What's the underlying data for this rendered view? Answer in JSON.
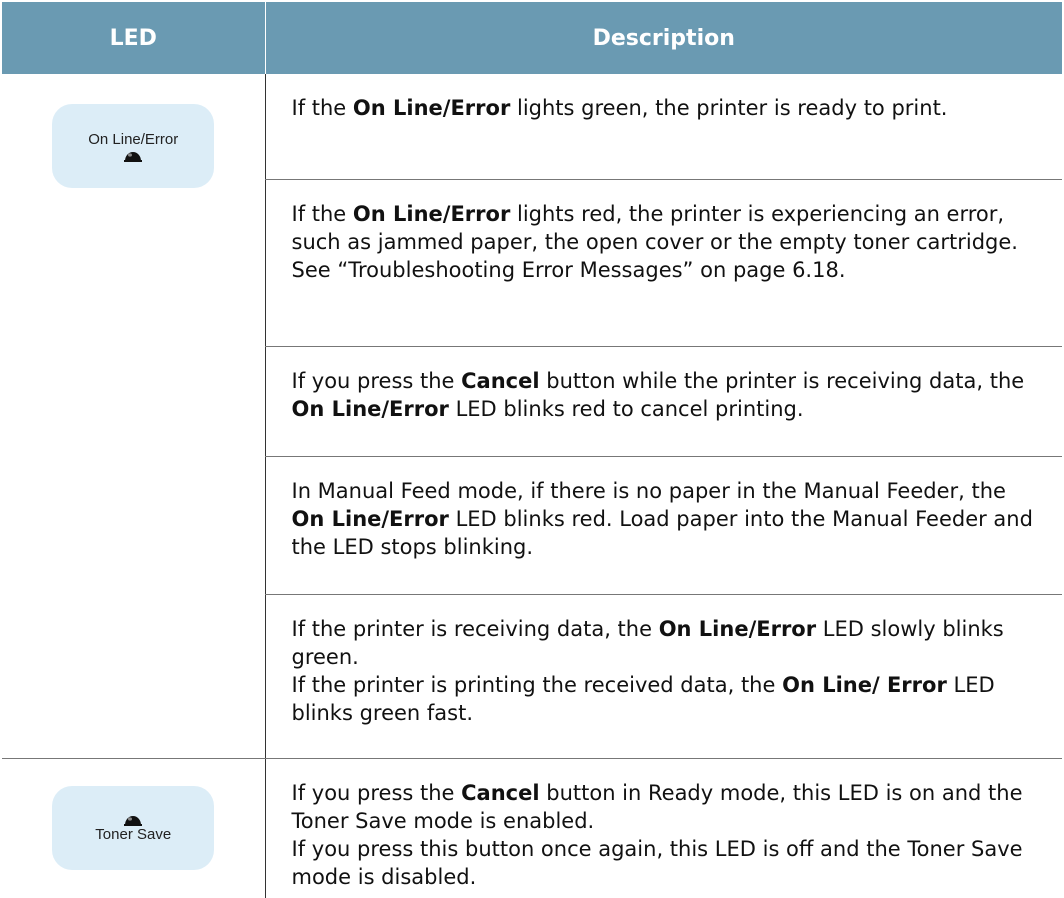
{
  "table": {
    "headers": {
      "led": "LED",
      "description": "Description"
    },
    "leds": {
      "online_error": {
        "label": "On Line/Error",
        "icon": "led-dot-icon"
      },
      "toner_save": {
        "label": "Toner Save",
        "icon": "led-dot-icon"
      }
    },
    "rows": [
      {
        "p1": "If the ",
        "b1": "On Line/Error",
        "p2": " lights green, the printer is ready to print."
      },
      {
        "p1": "If the ",
        "b1": "On Line/Error",
        "p2": " lights red, the printer is experiencing an error, such as jammed paper, the open cover or the empty toner cartridge. See “Troubleshooting Error Messages” on page 6.18."
      },
      {
        "p1": "If you press the ",
        "b1": "Cancel",
        "p2": " button while the printer is receiving data, the ",
        "b2": "On Line/Error",
        "p3": " LED blinks red to cancel printing."
      },
      {
        "p1": "In Manual Feed mode, if there is no paper in the Manual Feeder, the ",
        "b1": "On Line/Error",
        "p2": " LED blinks red. Load paper into the Manual Feeder and the LED stops blinking."
      },
      {
        "line1_p1": "If the printer is receiving data, the ",
        "line1_b1": "On Line/Error",
        "line1_p2": " LED slowly blinks green.",
        "line2_p1": "If the printer is printing the received data, the ",
        "line2_b1": "On Line/ Error",
        "line2_p2": " LED blinks green fast."
      },
      {
        "line1_p1": "If you press the ",
        "line1_b1": "Cancel",
        "line1_p2": " button in Ready mode, this LED is on and the Toner Save mode is enabled.",
        "line2": "If you press this button once again, this LED is off and the Toner Save mode is disabled."
      }
    ]
  },
  "colors": {
    "header_bg": "#6a9ab2",
    "badge_bg": "#dcedf7"
  }
}
